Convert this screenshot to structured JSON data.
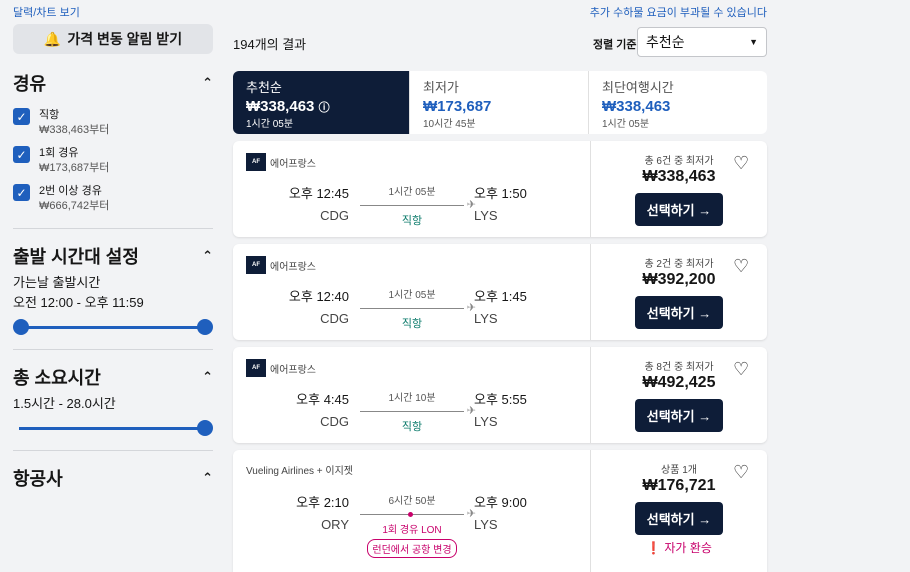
{
  "top": {
    "calendar_link": "달력/차트 보기",
    "fee_notice": "추가 수하물 요금이 부과될 수 있습니다"
  },
  "alert_button": "가격 변동 알림 받기",
  "sidebar": {
    "stops_title": "경유",
    "stops": [
      {
        "label": "직항",
        "price": "₩338,463부터"
      },
      {
        "label": "1회 경유",
        "price": "₩173,687부터"
      },
      {
        "label": "2번 이상 경유",
        "price": "₩666,742부터"
      }
    ],
    "departure_title": "출발 시간대 설정",
    "departure_sub": "가는날 출발시간",
    "departure_range": "오전 12:00 - 오후 11:59",
    "duration_title": "총 소요시간",
    "duration_range": "1.5시간 - 28.0시간",
    "airlines_title": "항공사"
  },
  "results": {
    "count": "194개의 결과",
    "sort_label": "정렬 기준",
    "sort_value": "추천순"
  },
  "tabs": [
    {
      "title": "추천순",
      "price": "₩338,463",
      "duration": "1시간 05분"
    },
    {
      "title": "최저가",
      "price": "₩173,687",
      "duration": "10시간 45분"
    },
    {
      "title": "최단여행시간",
      "price": "₩338,463",
      "duration": "1시간 05분"
    }
  ],
  "flights": [
    {
      "airline": "에어프랑스",
      "dep_time": "오후 12:45",
      "dep_code": "CDG",
      "duration": "1시간 05분",
      "stops": "직항",
      "arr_time": "오후 1:50",
      "arr_code": "LYS",
      "deal": "총 6건 중 최저가",
      "price": "₩338,463",
      "button": "선택하기 →"
    },
    {
      "airline": "에어프랑스",
      "dep_time": "오후 12:40",
      "dep_code": "CDG",
      "duration": "1시간 05분",
      "stops": "직항",
      "arr_time": "오후 1:45",
      "arr_code": "LYS",
      "deal": "총 2건 중 최저가",
      "price": "₩392,200",
      "button": "선택하기 →"
    },
    {
      "airline": "에어프랑스",
      "dep_time": "오후 4:45",
      "dep_code": "CDG",
      "duration": "1시간 10분",
      "stops": "직항",
      "arr_time": "오후 5:55",
      "arr_code": "LYS",
      "deal": "총 8건 중 최저가",
      "price": "₩492,425",
      "button": "선택하기 →"
    },
    {
      "airline": "Vueling Airlines + 이지젯",
      "dep_time": "오후 2:10",
      "dep_code": "ORY",
      "duration": "6시간 50분",
      "stops": "1회 경유 LON",
      "airport_change": "런던에서 공항 변경",
      "arr_time": "오후 9:00",
      "arr_code": "LYS",
      "deal": "상품 1개",
      "price": "₩176,721",
      "button": "선택하기 →",
      "self_transfer": "자가 환승"
    }
  ]
}
